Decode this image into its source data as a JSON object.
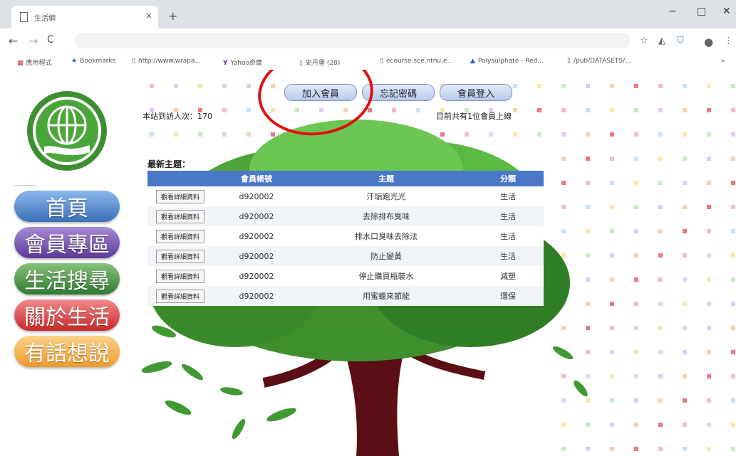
{
  "browser": {
    "tab_title": "生活網",
    "tab_close": "×",
    "new_tab": "+",
    "win_min": "−",
    "win_max": "□",
    "win_close": "✕",
    "back": "←",
    "forward": "→",
    "reload": "C",
    "bookmarks": [
      {
        "icon": "apps-icon",
        "label": "應用程式"
      },
      {
        "icon": "star-icon",
        "label": "Bookmarks"
      },
      {
        "icon": "page-icon",
        "label": "http://www.wrapa..."
      },
      {
        "icon": "yahoo-icon",
        "label": "Yahoo奇摩"
      },
      {
        "icon": "page-icon",
        "label": "史丹堡 (28)"
      },
      {
        "icon": "page-icon",
        "label": "ecourse.sce.ntnu.e..."
      },
      {
        "icon": "triangle-icon",
        "label": "Polysulphate - Red..."
      },
      {
        "icon": "page-icon",
        "label": "/pub/DATASETS/..."
      }
    ],
    "more": "»"
  },
  "header": {
    "join_label": "加入會員",
    "forgot_label": "忘記密碼",
    "login_label": "會員登入",
    "visit_count": "本站到訪人次：170",
    "online_text": "目前共有1位會員上線"
  },
  "sidebar": {
    "items": [
      {
        "label": "首頁",
        "color": "#4f86c6"
      },
      {
        "label": "會員專區",
        "color": "#6a4aa6"
      },
      {
        "label": "生活搜尋",
        "color": "#3d8a3d"
      },
      {
        "label": "關於生活",
        "color": "#d63a3a"
      },
      {
        "label": "有話想說",
        "color": "#f2a73a"
      }
    ]
  },
  "latest": {
    "title": "最新主題：",
    "columns": [
      "",
      "會員帳號",
      "主題",
      "分類"
    ],
    "view_label": "觀看詳細資料",
    "rows": [
      {
        "account": "d920002",
        "topic": "汗垢跑光光",
        "category": "生活"
      },
      {
        "account": "d920002",
        "topic": "去除排布臭味",
        "category": "生活"
      },
      {
        "account": "d920002",
        "topic": "排水口臭味去除法",
        "category": "生活"
      },
      {
        "account": "d920002",
        "topic": "防止變黃",
        "category": "生活"
      },
      {
        "account": "d920002",
        "topic": "停止購買瓶裝水",
        "category": "減塑"
      },
      {
        "account": "d920002",
        "topic": "用蜜蠟來節能",
        "category": "環保"
      }
    ]
  },
  "colors": {
    "accent_circle": "#e01010",
    "table_header": "#4a78c8"
  }
}
